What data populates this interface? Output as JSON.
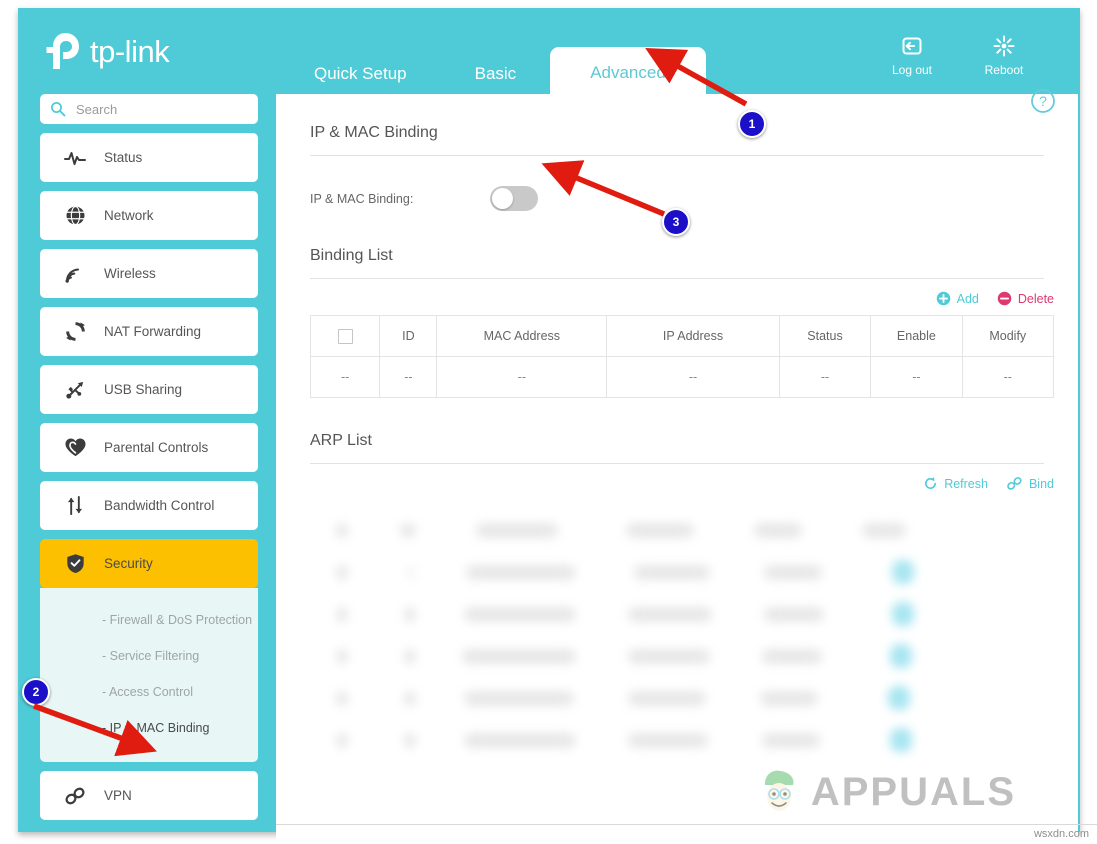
{
  "brand": {
    "name": "tp-link",
    "logo_icon": "tp-link-logo-icon",
    "accent_teal": "#4ecbd7",
    "accent_yellow": "#fcc000"
  },
  "tabs": [
    {
      "label": "Quick Setup",
      "active": false
    },
    {
      "label": "Basic",
      "active": false
    },
    {
      "label": "Advanced",
      "active": true
    }
  ],
  "top_actions": [
    {
      "label": "Log out",
      "icon": "logout-icon"
    },
    {
      "label": "Reboot",
      "icon": "reboot-icon"
    }
  ],
  "search": {
    "placeholder": "Search",
    "value": "",
    "icon": "search-icon"
  },
  "sidebar": {
    "items": [
      {
        "label": "Status",
        "icon": "pulse-icon"
      },
      {
        "label": "Network",
        "icon": "globe-icon"
      },
      {
        "label": "Wireless",
        "icon": "wifi-icon"
      },
      {
        "label": "NAT Forwarding",
        "icon": "refresh-circle-icon"
      },
      {
        "label": "USB Sharing",
        "icon": "usb-icon"
      },
      {
        "label": "Parental Controls",
        "icon": "heart-icon"
      },
      {
        "label": "Bandwidth Control",
        "icon": "up-down-arrows-icon"
      },
      {
        "label": "Security",
        "icon": "shield-icon",
        "active": true
      },
      {
        "label": "VPN",
        "icon": "link-chain-icon"
      }
    ],
    "security_subitems": [
      {
        "label": "- Firewall & DoS Protection",
        "active": false
      },
      {
        "label": "- Service Filtering",
        "active": false
      },
      {
        "label": "- Access Control",
        "active": false
      },
      {
        "label": "- IP & MAC Binding",
        "active": true
      }
    ]
  },
  "main": {
    "help_icon": "help-circle-icon",
    "binding_section": {
      "title": "IP & MAC Binding",
      "toggle_label": "IP & MAC Binding:",
      "toggle_state": "off"
    },
    "binding_list": {
      "title": "Binding List",
      "actions": [
        {
          "label": "Add",
          "icon": "plus-circle-icon",
          "color": "#4ecbd7"
        },
        {
          "label": "Delete",
          "icon": "minus-circle-icon",
          "color": "#e0386f"
        }
      ],
      "columns": [
        "",
        "ID",
        "MAC Address",
        "IP Address",
        "Status",
        "Enable",
        "Modify"
      ],
      "rows": [
        [
          "--",
          "--",
          "--",
          "--",
          "--",
          "--",
          "--"
        ]
      ]
    },
    "arp_list": {
      "title": "ARP List",
      "actions": [
        {
          "label": "Refresh",
          "icon": "refresh-icon",
          "color": "#4ecbd7"
        },
        {
          "label": "Bind",
          "icon": "link-icon",
          "color": "#4ecbd7"
        }
      ],
      "blurred_row_count": 6
    }
  },
  "annotations": [
    {
      "number": "1",
      "target": "advanced-tab"
    },
    {
      "number": "2",
      "target": "ip-mac-binding-sidebar-item"
    },
    {
      "number": "3",
      "target": "ip-mac-binding-toggle"
    }
  ],
  "watermark": {
    "text": "APPUALS",
    "mascot": "appuals-mascot-icon"
  },
  "site_credit": "wsxdn.com"
}
